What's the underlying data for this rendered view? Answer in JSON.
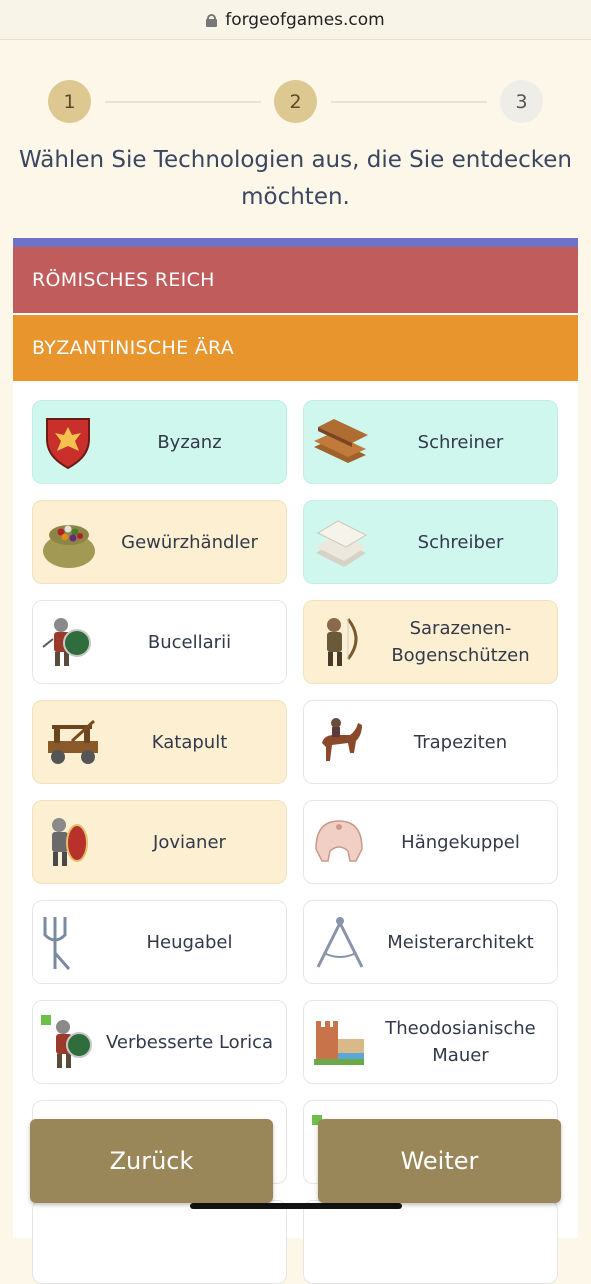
{
  "browser": {
    "url": "forgeofgames.com"
  },
  "steps": [
    "1",
    "2",
    "3"
  ],
  "headline": "Wählen Sie Technologien aus, die Sie entdecken möchten.",
  "eras": {
    "roman": "RÖMISCHES REICH",
    "byzantine": "BYZANTINISCHE ÄRA"
  },
  "techs": [
    {
      "label": "Byzanz",
      "icon": "shield-eagle-icon"
    },
    {
      "label": "Schreiner",
      "icon": "wood-planks-icon"
    },
    {
      "label": "Gewürzhändler",
      "icon": "spice-sack-icon"
    },
    {
      "label": "Schreiber",
      "icon": "paper-stack-icon"
    },
    {
      "label": "Bucellarii",
      "icon": "soldier-shield-icon"
    },
    {
      "label": "Sarazenen-Bogenschützen",
      "icon": "archer-icon"
    },
    {
      "label": "Katapult",
      "icon": "catapult-icon"
    },
    {
      "label": "Trapeziten",
      "icon": "horse-rider-icon"
    },
    {
      "label": "Jovianer",
      "icon": "soldier-red-shield-icon"
    },
    {
      "label": "Hängekuppel",
      "icon": "dome-icon"
    },
    {
      "label": "Heugabel",
      "icon": "pitchfork-icon"
    },
    {
      "label": "Meisterarchitekt",
      "icon": "compass-icon"
    },
    {
      "label": "Verbesserte Lorica",
      "icon": "soldier-upgrade-icon"
    },
    {
      "label": "Theodosianische Mauer",
      "icon": "city-wall-icon"
    }
  ],
  "buttons": {
    "back": "Zurück",
    "next": "Weiter"
  },
  "colors": {
    "teal": "#cff7ee",
    "sand": "#fcefd2",
    "roman": "#c05c5c",
    "byzantine": "#e8952e",
    "button": "#9a8759"
  }
}
